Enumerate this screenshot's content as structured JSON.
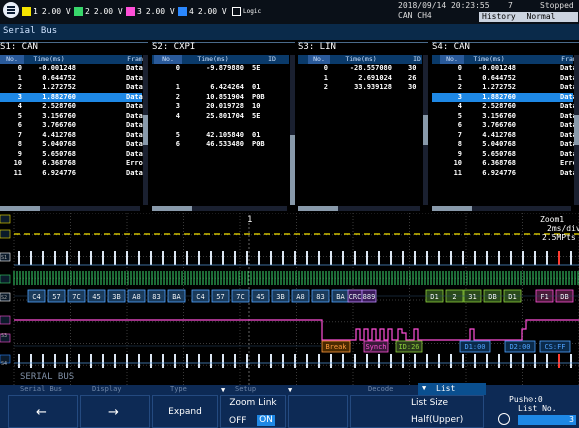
{
  "topbar": {
    "channels": [
      {
        "num": "1",
        "value": "2.00 V",
        "color": "#f5e400"
      },
      {
        "num": "2",
        "value": "2.00 V",
        "color": "#38d66b"
      },
      {
        "num": "3",
        "value": "2.00 V",
        "color": "#ff4fd8"
      },
      {
        "num": "4",
        "value": "2.00 V",
        "color": "#2b88ff"
      }
    ],
    "logic_label": "Logic",
    "datetime": "2018/09/14 20:23:55",
    "can_ch": "CAN CH4",
    "count": "7",
    "status": "Stopped",
    "history": "History",
    "mode": "Normal"
  },
  "title": "Serial Bus",
  "panels": [
    {
      "title": "S1: CAN",
      "headers": [
        "No.",
        "Time(ms)",
        "Fram"
      ],
      "rows": [
        [
          "0",
          "-0.001248",
          "Data"
        ],
        [
          "1",
          "0.644752",
          "Data"
        ],
        [
          "2",
          "1.272752",
          "Data"
        ],
        [
          "3",
          "1.882760",
          "Data"
        ],
        [
          "4",
          "2.528760",
          "Data"
        ],
        [
          "5",
          "3.156760",
          "Data"
        ],
        [
          "6",
          "3.766760",
          "Data"
        ],
        [
          "7",
          "4.412768",
          "Data"
        ],
        [
          "8",
          "5.040768",
          "Data"
        ],
        [
          "9",
          "5.650768",
          "Data"
        ],
        [
          "10",
          "6.368768",
          "Erro"
        ],
        [
          "11",
          "6.924776",
          "Data"
        ]
      ],
      "selected": 3
    },
    {
      "title": "S2: CXPI",
      "headers": [
        "No.",
        "Time(ms)",
        "ID"
      ],
      "rows": [
        [
          "0",
          "-9.879880",
          "5E"
        ],
        [
          "",
          "",
          ""
        ],
        [
          "1",
          "6.424264",
          "01"
        ],
        [
          "2",
          "10.851904",
          "P0B"
        ],
        [
          "3",
          "20.019728",
          "10"
        ],
        [
          "4",
          "25.801704",
          "5E"
        ],
        [
          "",
          "",
          ""
        ],
        [
          "5",
          "42.105840",
          "01"
        ],
        [
          "6",
          "46.533480",
          "P0B"
        ]
      ],
      "selected": -1
    },
    {
      "title": "S3: LIN",
      "headers": [
        "No.",
        "Time(ms)",
        "ID"
      ],
      "rows": [
        [
          "0",
          "-28.557080",
          "30"
        ],
        [
          "1",
          "2.691024",
          "26"
        ],
        [
          "2",
          "33.939128",
          "30"
        ]
      ],
      "selected": -1
    },
    {
      "title": "S4: CAN",
      "headers": [
        "No.",
        "Time(ms)",
        "Fram"
      ],
      "rows": [
        [
          "0",
          "-0.001248",
          "Data"
        ],
        [
          "1",
          "0.644752",
          "Data"
        ],
        [
          "2",
          "1.272752",
          "Data"
        ],
        [
          "3",
          "1.882760",
          "Data"
        ],
        [
          "4",
          "2.528760",
          "Data"
        ],
        [
          "5",
          "3.156760",
          "Data"
        ],
        [
          "6",
          "3.766760",
          "Data"
        ],
        [
          "7",
          "4.412768",
          "Data"
        ],
        [
          "8",
          "5.040768",
          "Data"
        ],
        [
          "9",
          "5.650768",
          "Data"
        ],
        [
          "10",
          "6.368768",
          "Erro"
        ],
        [
          "11",
          "6.924776",
          "Data"
        ]
      ],
      "selected": 3
    }
  ],
  "wave": {
    "zoom": "Zoom1",
    "timebase": "2ms/div",
    "pts": "2.5MPts",
    "ch_labels": [
      "S1",
      "S2",
      "S3",
      "S4"
    ],
    "can_bytes": [
      "C4",
      "57",
      "7C",
      "45",
      "3B",
      "A8",
      "83",
      "BA",
      "C4",
      "57",
      "7C",
      "45",
      "3B",
      "A8",
      "83",
      "BA",
      "CRC",
      "889",
      "D1",
      "2",
      "31",
      "DB",
      "D1",
      "F1",
      "DB"
    ],
    "lin_labels": [
      "Break",
      "Synch",
      "ID:26",
      "D1:00",
      "D2:00",
      "CS:FF"
    ],
    "marker": "1"
  },
  "bottom": {
    "serial_bus": "SERIAL BUS",
    "tabs": [
      "Serial Bus",
      "Display",
      "Type",
      "Setup",
      "",
      "Decode",
      "List"
    ],
    "left_arrow": "←",
    "right_arrow": "→",
    "expand": "Expand",
    "zoom_link": "Zoom Link",
    "off": "OFF",
    "on": "ON",
    "list_size": "List Size",
    "half_upper": "Half(Upper)",
    "push": "Push",
    "push_val": ":0",
    "list_no": "List No.",
    "list_no_val": "3"
  }
}
